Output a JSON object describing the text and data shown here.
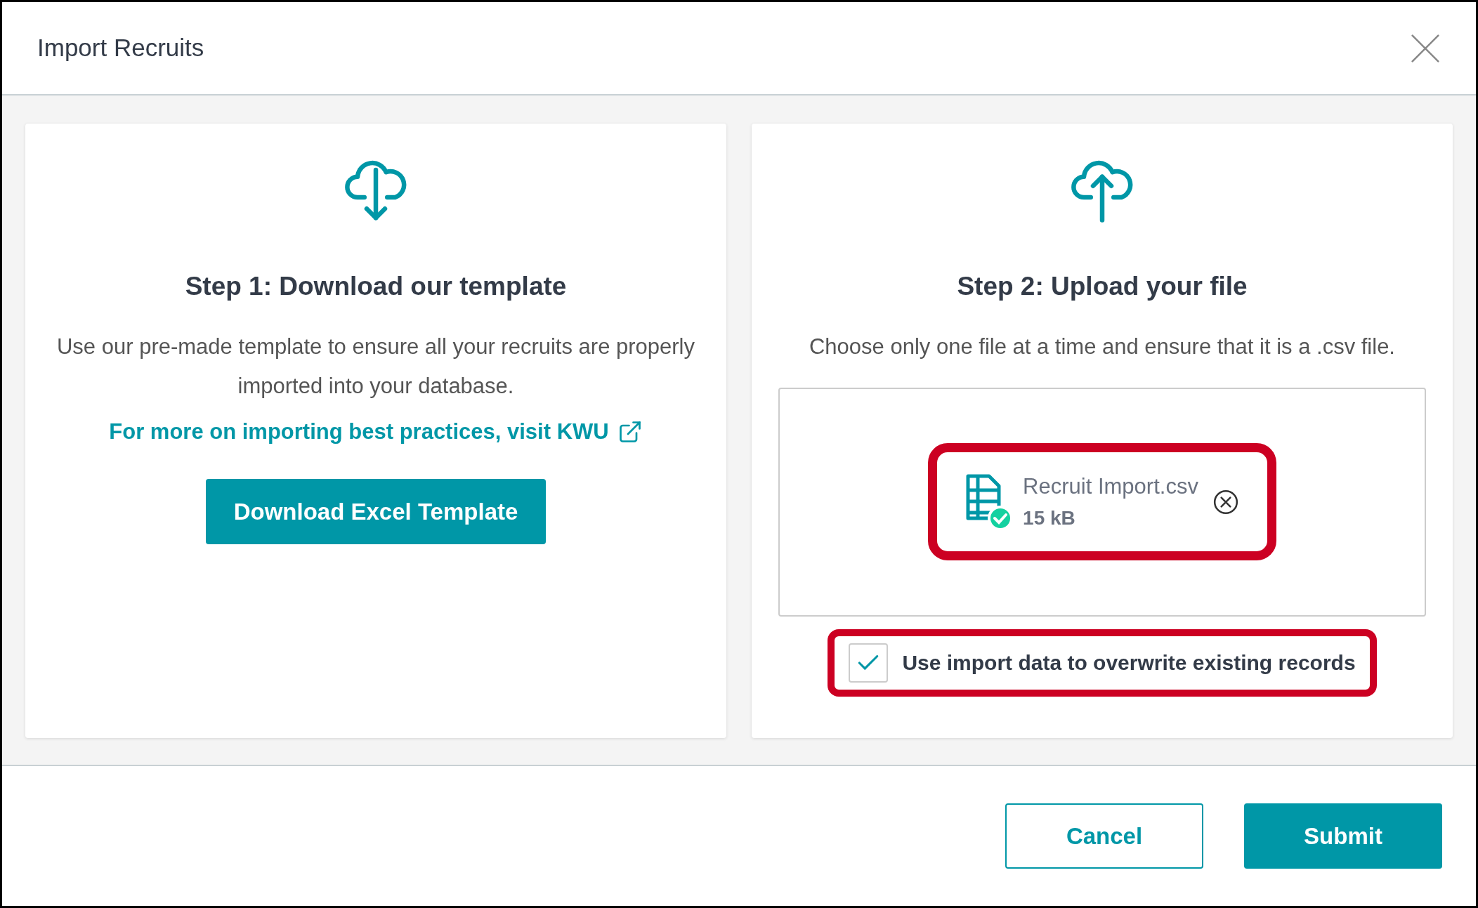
{
  "dialog": {
    "title": "Import Recruits"
  },
  "steps": [
    {
      "kind": "download",
      "heading": "Step 1: Download our template",
      "description": "Use our pre-made template to ensure all your recruits are properly imported into your database.",
      "link": "For more on importing best practices, visit KWU",
      "button": "Download Excel Template"
    },
    {
      "kind": "upload",
      "heading": "Step 2: Upload your file",
      "description": "Choose only one file at a time and ensure that it is a .csv file.",
      "file": {
        "name": "Recruit Import.csv",
        "size": "15 kB",
        "highlighted": true
      },
      "overwrite": {
        "label": "Use import data to overwrite existing records",
        "checked": true,
        "highlighted": true
      }
    }
  ],
  "footer": {
    "buttons": [
      {
        "label": "Cancel",
        "kind": "secondary"
      },
      {
        "label": "Submit",
        "kind": "primary"
      }
    ]
  }
}
